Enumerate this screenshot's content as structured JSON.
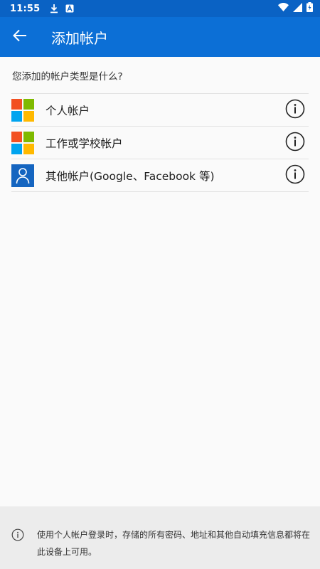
{
  "status_bar": {
    "time": "11:55",
    "icons": [
      "download-icon",
      "notification-a-icon",
      "wifi-icon",
      "signal-icon",
      "battery-charging-icon"
    ]
  },
  "app_bar": {
    "back_icon": "arrow-left-icon",
    "title": "添加帐户"
  },
  "prompt": "您添加的帐户类型是什么?",
  "accounts": [
    {
      "label": "个人帐户",
      "icon": "microsoft-logo-icon",
      "info_icon": "info-icon"
    },
    {
      "label": "工作或学校帐户",
      "icon": "microsoft-logo-icon",
      "info_icon": "info-icon"
    },
    {
      "label": "其他帐户(Google、Facebook 等)",
      "icon": "person-icon",
      "info_icon": "info-icon"
    }
  ],
  "footer": {
    "icon": "info-icon",
    "text": "使用个人帐户登录时，存储的所有密码、地址和其他自动填充信息都将在此设备上可用。"
  },
  "colors": {
    "status_bar": "#0a62c4",
    "app_bar": "#0c6fd6",
    "ms_red": "#f25022",
    "ms_green": "#7fba00",
    "ms_blue": "#00a4ef",
    "ms_yellow": "#ffb900",
    "person_icon_bg": "#1565c0",
    "footer_bg": "#ececec"
  }
}
